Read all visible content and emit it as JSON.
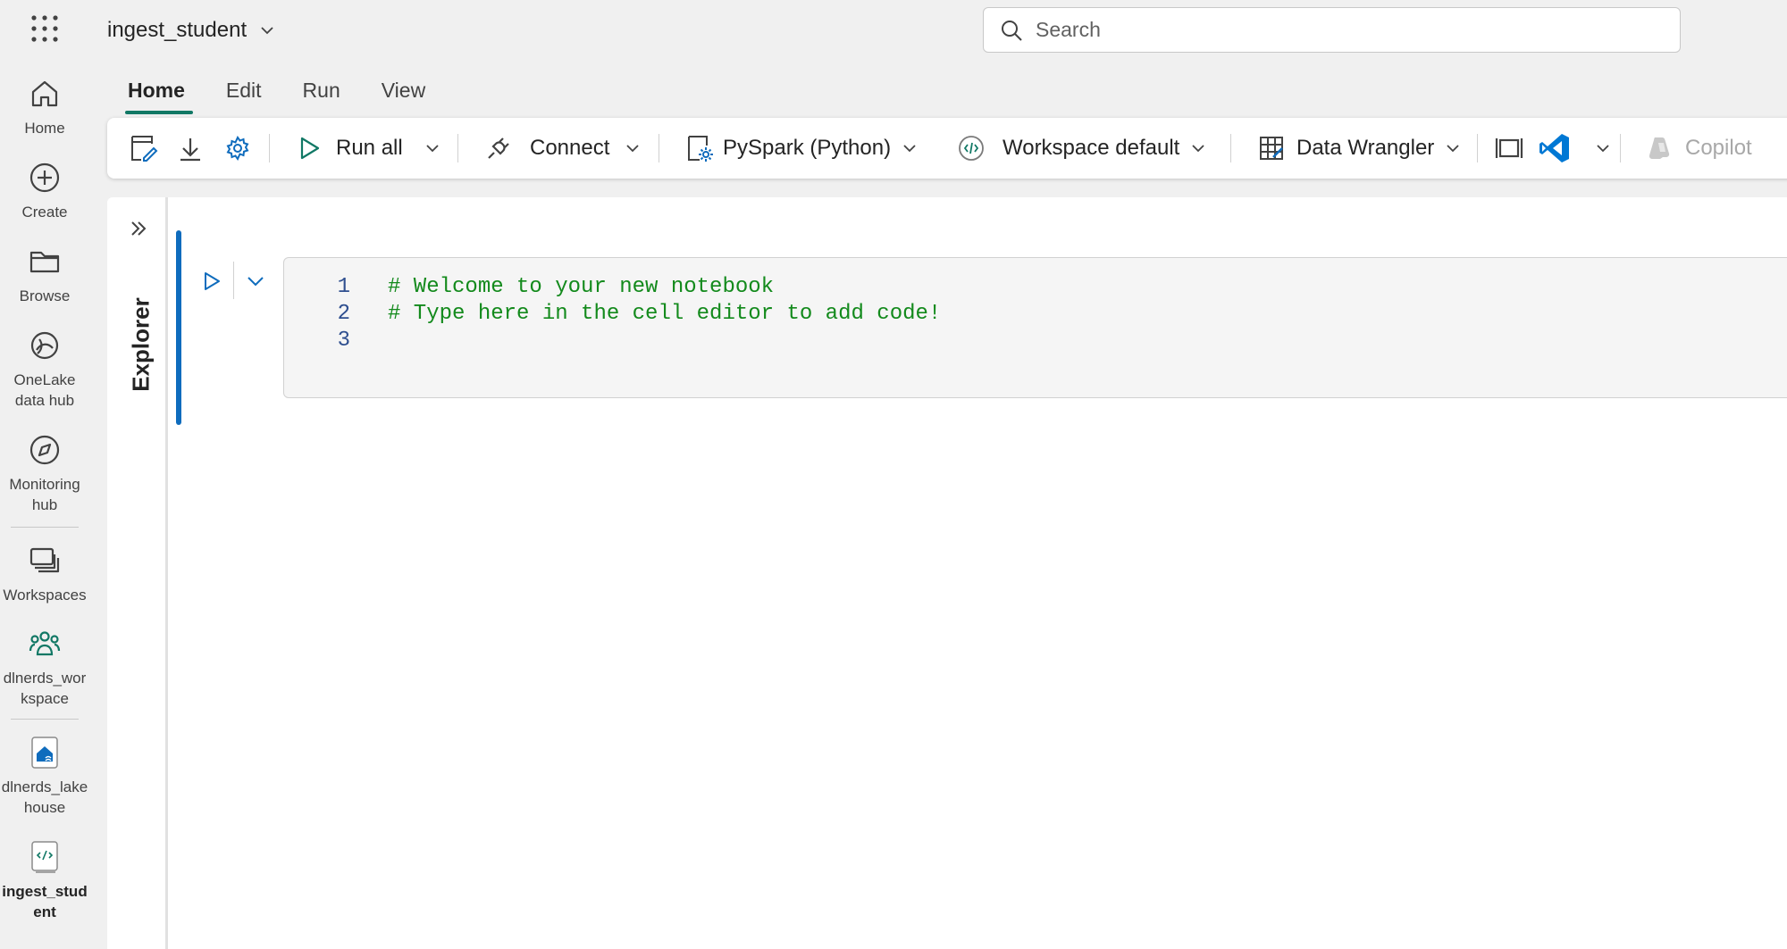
{
  "app": {
    "notebook_title": "ingest_student"
  },
  "search": {
    "placeholder": "Search"
  },
  "rail": {
    "items": [
      {
        "label": "Home",
        "icon": "home-icon"
      },
      {
        "label": "Create",
        "icon": "plus-circle-icon"
      },
      {
        "label": "Browse",
        "icon": "folder-icon"
      },
      {
        "label": "OneLake\ndata hub",
        "icon": "onelake-icon"
      },
      {
        "label": "Monitoring\nhub",
        "icon": "compass-icon"
      },
      {
        "label": "Workspaces",
        "icon": "workspaces-icon"
      },
      {
        "label": "dlnerds_wor\nkspace",
        "icon": "people-icon"
      },
      {
        "label": "dlnerds_lake\nhouse",
        "icon": "lakehouse-icon"
      },
      {
        "label": "ingest_stud\nent",
        "icon": "notebook-icon"
      }
    ]
  },
  "tabs": [
    {
      "label": "Home",
      "active": true
    },
    {
      "label": "Edit",
      "active": false
    },
    {
      "label": "Run",
      "active": false
    },
    {
      "label": "View",
      "active": false
    }
  ],
  "toolbar": {
    "run_all": "Run all",
    "connect": "Connect",
    "language": "PySpark (Python)",
    "environment": "Workspace default",
    "data_wrangler": "Data Wrangler",
    "copilot": "Copilot"
  },
  "explorer": {
    "label": "Explorer"
  },
  "cell": {
    "lines": [
      {
        "number": "1",
        "code": "# Welcome to your new notebook"
      },
      {
        "number": "2",
        "code": "# Type here in the cell editor to add code!"
      },
      {
        "number": "3",
        "code": ""
      }
    ]
  },
  "colors": {
    "accent": "#117865",
    "cell_indicator": "#0f6cbd",
    "comment": "#138a1c",
    "vscode": "#0078d4"
  }
}
